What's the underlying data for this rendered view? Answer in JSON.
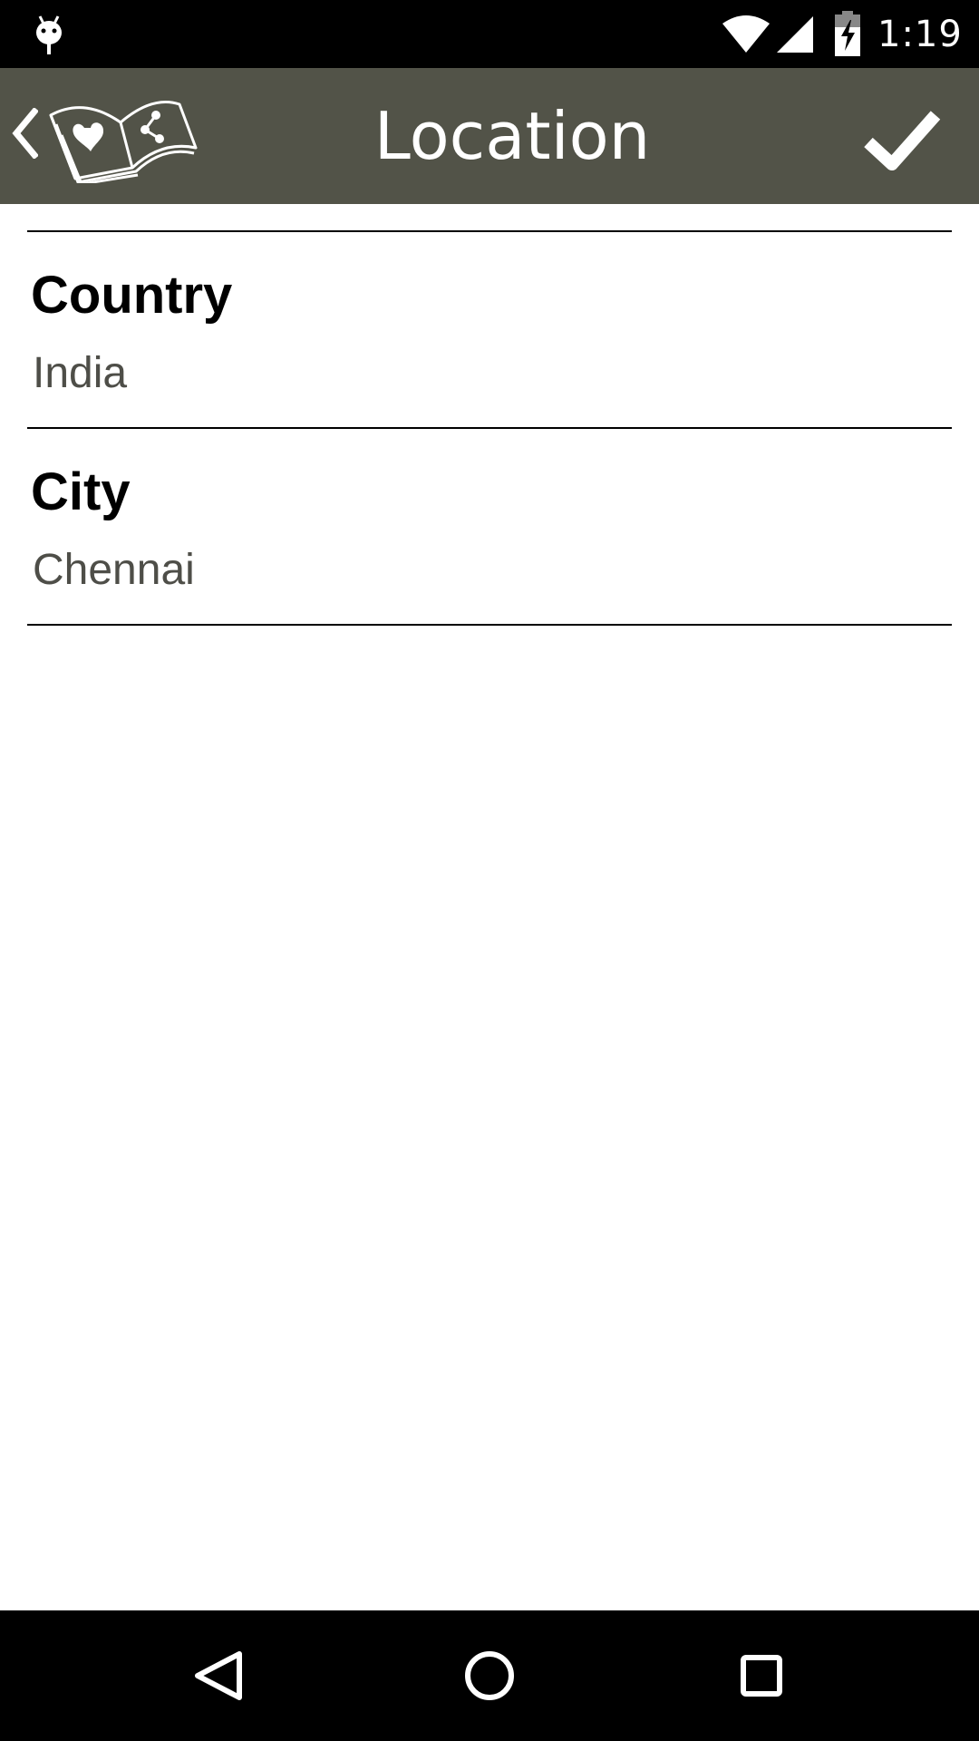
{
  "status_bar": {
    "time": "1:19",
    "icons": [
      "debug-icon",
      "wifi-icon",
      "signal-icon",
      "battery-charging-icon"
    ]
  },
  "app_bar": {
    "title": "Location",
    "back_icon": "chevron-left-icon",
    "logo_icon": "book-heart-share-icon",
    "done_icon": "checkmark-icon",
    "background_color": "#525348"
  },
  "fields": [
    {
      "label": "Country",
      "value": "India"
    },
    {
      "label": "City",
      "value": "Chennai"
    }
  ],
  "nav_bar": {
    "icons": [
      "back-triangle-icon",
      "home-circle-icon",
      "recents-square-icon"
    ]
  }
}
